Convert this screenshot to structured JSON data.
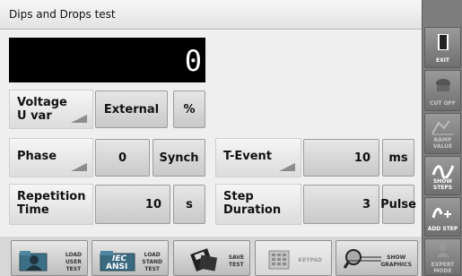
{
  "window": {
    "title": "Dips and Drops test"
  },
  "display": {
    "value": "0"
  },
  "voltage": {
    "label_line1": "Voltage",
    "label_line2": "U var",
    "mode": "External",
    "unit": "%"
  },
  "phase": {
    "label": "Phase",
    "value": "0",
    "mode": "Synch"
  },
  "t_event": {
    "label": "T-Event",
    "value": "10",
    "unit": "ms"
  },
  "repetition": {
    "label_line1": "Repetition",
    "label_line2": "Time",
    "value": "10",
    "unit": "s"
  },
  "step": {
    "label_line1": "Step",
    "label_line2": "Duration",
    "value": "3",
    "mode": "Pulse"
  },
  "sidebar": {
    "exit": "EXIT",
    "cut_off": "CUT OFF",
    "ramp_value": "RAMP VALUE",
    "show_steps": "SHOW STEPS",
    "add_step": "ADD STEP",
    "expert_mode_1": "EXPERT",
    "expert_mode_2": "MODE"
  },
  "bottom": {
    "load_user_test_1": "LOAD",
    "load_user_test_2": "USER",
    "load_user_test_3": "TEST",
    "iec_logo_1": "IEC",
    "iec_logo_2": "ANSI",
    "load_stand_test_1": "LOAD",
    "load_stand_test_2": "STAND",
    "load_stand_test_3": "TEST",
    "save_test_1": "SAVE",
    "save_test_2": "TEST",
    "keypad": "KEYPAD",
    "show_graphics_1": "SHOW",
    "show_graphics_2": "GRAPHICS"
  }
}
